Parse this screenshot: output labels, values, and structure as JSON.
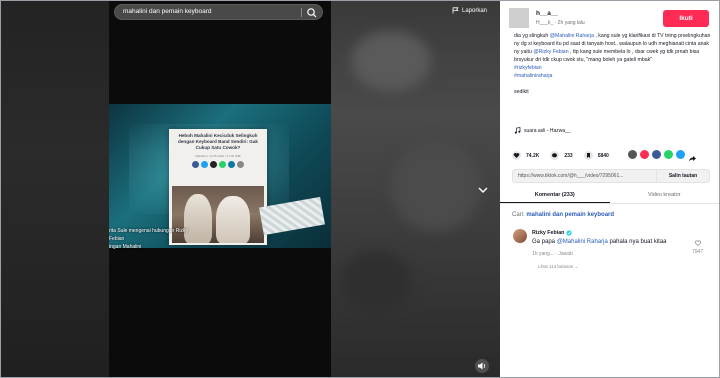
{
  "search": {
    "query": "mahalini dan pemain keyboard"
  },
  "report_label": "Laporkan",
  "video": {
    "article_title": "Heboh Mahalini Kecicduk Selingkuh dengan Keyboard Band Sendiri: Gak Cukup Satu Cowok?",
    "article_subtitle": "Mahalini | 12.05.2023 | 17.00 WIB",
    "caption": "rita Sule mengenai hubungan Rizky Febian\ningan Mahalini"
  },
  "author": {
    "name": "h__a__",
    "sub": "H___k_ · 2h yang lalu",
    "follow_label": "Ikuti"
  },
  "description": {
    "text1": "dia yg slingkuh ",
    "mention1": "@Mahalini Raharja",
    "text2": " , kang sule yg klarifikasi di TV tntng prselingkuhan ny dg si keyboard itu pd saat di tanyain host.. walaupun lo udh meghianati cinta anak ny yaitu ",
    "mention2": "@Rizky Febian",
    "text3": " , ttp kang sule membela lo , dsar cwek yg tdk prnah bisa brsyukur dri tdk ckup cwok stu, \"mang boleh ya gateli mbak\"",
    "tag1": "#rizkyfebian",
    "tag2": "#mahaliniraharja",
    "extra": "sedikit"
  },
  "music": "suara asli - Hazwa__",
  "stats": {
    "likes": "74.2K",
    "comments": "233",
    "saves": "5840"
  },
  "link": {
    "url": "https://www.tiktok.com/@h___/video/7295061...",
    "copy_label": "Salin tautan"
  },
  "tabs": [
    {
      "label": "Komentar (233)"
    },
    {
      "label": "Video kreator"
    }
  ],
  "comment_search": {
    "prefix": "Cari: ",
    "query": "mahalini dan pemain keyboard"
  },
  "comment": {
    "author": "Rizky Febian",
    "text_prefix": "Ga papa ",
    "mention": "@Mahalini Raharja",
    "text_suffix": " pahala nya buat kitaa",
    "meta": "1h yang... · Jawab",
    "likes": "7947",
    "more": "Lihat 114 balasan ⌄"
  },
  "colors": {
    "accent": "#fe2c55",
    "link": "#2b5db9"
  }
}
